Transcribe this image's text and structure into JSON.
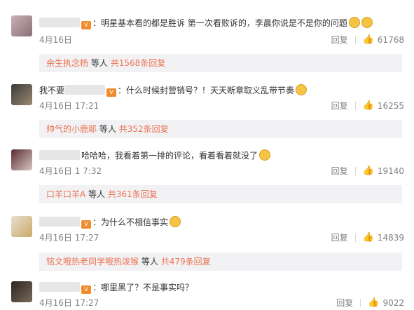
{
  "comments": [
    {
      "text": "：明星基本看的都是胜诉  第一次看败诉的，李晨你说是不是你的问题",
      "time": "4月16日",
      "reply_label": "回复",
      "likes": "61768",
      "reply_user": "余生执念杨",
      "reply_mid": "等人",
      "reply_total": "共1568条回复",
      "emoji_count": 2,
      "user_prefix": ""
    },
    {
      "text": "：什么时候封营销号？！天天断章取义乱带节奏",
      "time": "4月16日 17:21",
      "reply_label": "回复",
      "likes": "16255",
      "reply_user": "帅气的小鹿耶",
      "reply_mid": "等人",
      "reply_total": "共352条回复",
      "emoji_count": 1,
      "user_prefix": "我不要"
    },
    {
      "text": "哈哈哈，我看着第一排的评论，看着看着就没了",
      "time": "4月16日 1 7:32",
      "reply_label": "回复",
      "likes": "19140",
      "reply_user": "口羊口羊A",
      "reply_mid": "等人",
      "reply_total": "共361条回复",
      "emoji_count": 1,
      "user_prefix": ""
    },
    {
      "text": "：为什么不相信事实",
      "time": "4月16日 17:27",
      "reply_label": "回复",
      "likes": "14839",
      "reply_user": "铭文哦热老同学哦热泼猴",
      "reply_mid": "等人",
      "reply_total": "共479条回复",
      "emoji_count": 1,
      "user_prefix": ""
    },
    {
      "text": "：哪里黑了？不是事实吗？",
      "time": "4月16日 17:27",
      "reply_label": "回复",
      "likes": "9022",
      "emoji_count": 0,
      "user_prefix": ""
    }
  ]
}
